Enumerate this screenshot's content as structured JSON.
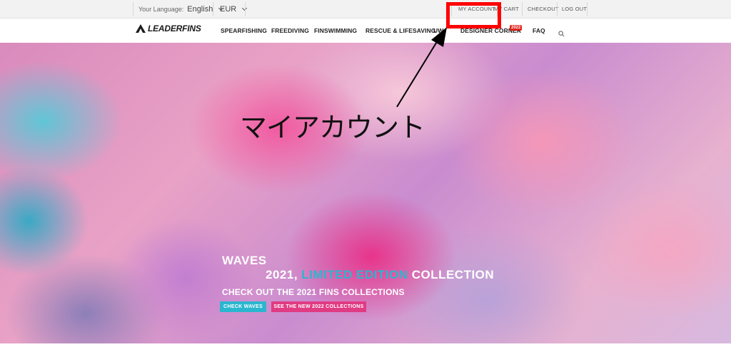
{
  "topbar": {
    "language_label": "Your Language:",
    "language_value": "English",
    "currency_value": "EUR",
    "links": [
      "MY ACCOUNT",
      "MY CART",
      "CHECKOUT",
      "LOG OUT"
    ]
  },
  "nav": {
    "brand": "LEADERFINS",
    "items": [
      "SPEARFISHING",
      "FREEDIVING",
      "FINSWIMMING",
      "RESCUE & LIFESAVING",
      "UW",
      "DESIGNER CORNER",
      "FAQ"
    ],
    "designer_badge": "2022"
  },
  "hero": {
    "line1": "WAVES",
    "line2_year": "2021,",
    "line2_accent": "LIMITED EDITION",
    "line2_end": "COLLECTION",
    "subtitle": "CHECK OUT THE 2021 FINS COLLECTIONS",
    "button_primary": "CHECK WAVES",
    "button_secondary": "SEE THE NEW 2022 COLLECTIONS"
  },
  "annotation": {
    "text": "マイアカウント"
  },
  "colors": {
    "accent_teal": "#2bb6cf",
    "accent_pink": "#e03b83",
    "badge_red": "#e2231a",
    "annotation_red": "#ff0000"
  }
}
